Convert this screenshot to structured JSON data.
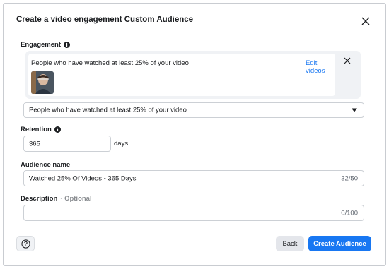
{
  "dialog": {
    "title": "Create a video engagement Custom Audience"
  },
  "engagement": {
    "label": "Engagement",
    "selected_text": "People who have watched at least 25% of your video",
    "edit_link": "Edit videos",
    "dropdown_value": "People who have watched at least 25% of your video"
  },
  "retention": {
    "label": "Retention",
    "value": "365",
    "unit": "days"
  },
  "audience_name": {
    "label": "Audience name",
    "value": "Watched 25% Of Videos - 365 Days",
    "counter": "32/50"
  },
  "description": {
    "label": "Description",
    "optional": "· Optional",
    "value": "",
    "counter": "0/100"
  },
  "footer": {
    "back_label": "Back",
    "create_label": "Create Audience"
  },
  "colors": {
    "primary": "#1877f2",
    "secondary_button": "#e4e6eb",
    "border": "#ccd0d5"
  },
  "icons": [
    "close-icon",
    "info-icon",
    "remove-icon",
    "chevron-down-icon",
    "help-icon"
  ]
}
